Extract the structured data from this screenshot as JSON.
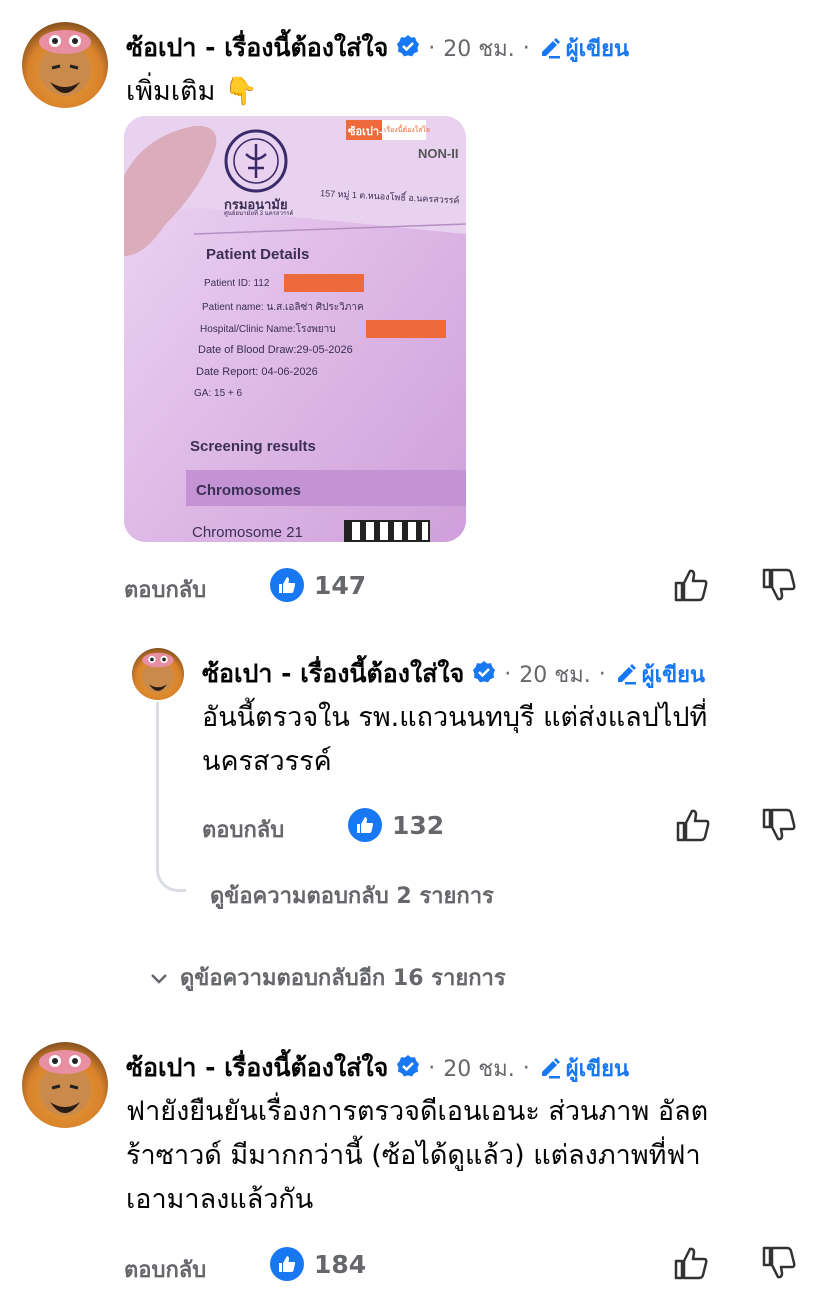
{
  "comments": [
    {
      "author": "ซ้อเปา - เรื่องนี้ต้องใส่ใจ",
      "separator": "·",
      "time": "20 ชม.",
      "badge": "ผู้เขียน",
      "text": "เพิ่มเติม 👇",
      "reply_label": "ตอบกลับ",
      "likes": "147",
      "photo": {
        "logo_caption": "กรมอนามัย",
        "logo_sub": "ศูนย์อนามัยที่ 3 นครสวรรค์",
        "watermark": "ซ้อเปา-",
        "watermark_sub": "เรื่องนี้ต้องใส่ใจ",
        "corner_text": "NON-II",
        "address": "157 หมู่ 1 ต.หนองโพธิ์ อ.นครสวรรค์",
        "heading": "Patient Details",
        "patient_id": "Patient ID: 112",
        "patient_name": "Patient name: น.ส.เอลิซ่า ศิประวิภาค",
        "hospital": "Hospital/Clinic Name:โรงพยาบ",
        "blood_draw": "Date of Blood Draw:29-05-2026",
        "report": "Date Report: 04-06-2026",
        "ga": "GA: 15 + 6",
        "screening": "Screening results",
        "chromosomes": "Chromosomes",
        "chromosome_21": "Chromosome 21"
      }
    },
    {
      "author": "ซ้อเปา - เรื่องนี้ต้องใส่ใจ",
      "separator": "·",
      "time": "20 ชม.",
      "badge": "ผู้เขียน",
      "text_line1": "อันนี้ตรวจใน รพ.แถวนนทบุรี แต่ส่งแลปไปที่",
      "text_line2": "นครสวรรค์",
      "reply_label": "ตอบกลับ",
      "likes": "132",
      "view_replies": "ดูข้อความตอบกลับ 2 รายการ"
    },
    {
      "author": "ซ้อเปา - เรื่องนี้ต้องใส่ใจ",
      "separator": "·",
      "time": "20 ชม.",
      "badge": "ผู้เขียน",
      "text_line1": "ฟายังยืนยันเรื่องการตรวจดีเอนเอนะ ส่วนภาพ อัลต",
      "text_line2": "ร้าซาวด์ มีมากกว่านี้ (ซ้อได้ดูแล้ว) แต่ลงภาพที่ฟา",
      "text_line3": "เอามาลงแล้วกัน",
      "reply_label": "ตอบกลับ",
      "likes": "184"
    }
  ],
  "more_replies": "ดูข้อความตอบกลับอีก 16 รายการ",
  "colors": {
    "accent": "#1877f2",
    "muted": "#65676b",
    "thread": "#dadde1"
  },
  "icons": [
    "verified-badge-icon",
    "pencil-icon",
    "thumbs-up-icon",
    "thumbs-down-icon",
    "like-reaction-icon",
    "chevron-down-icon"
  ]
}
